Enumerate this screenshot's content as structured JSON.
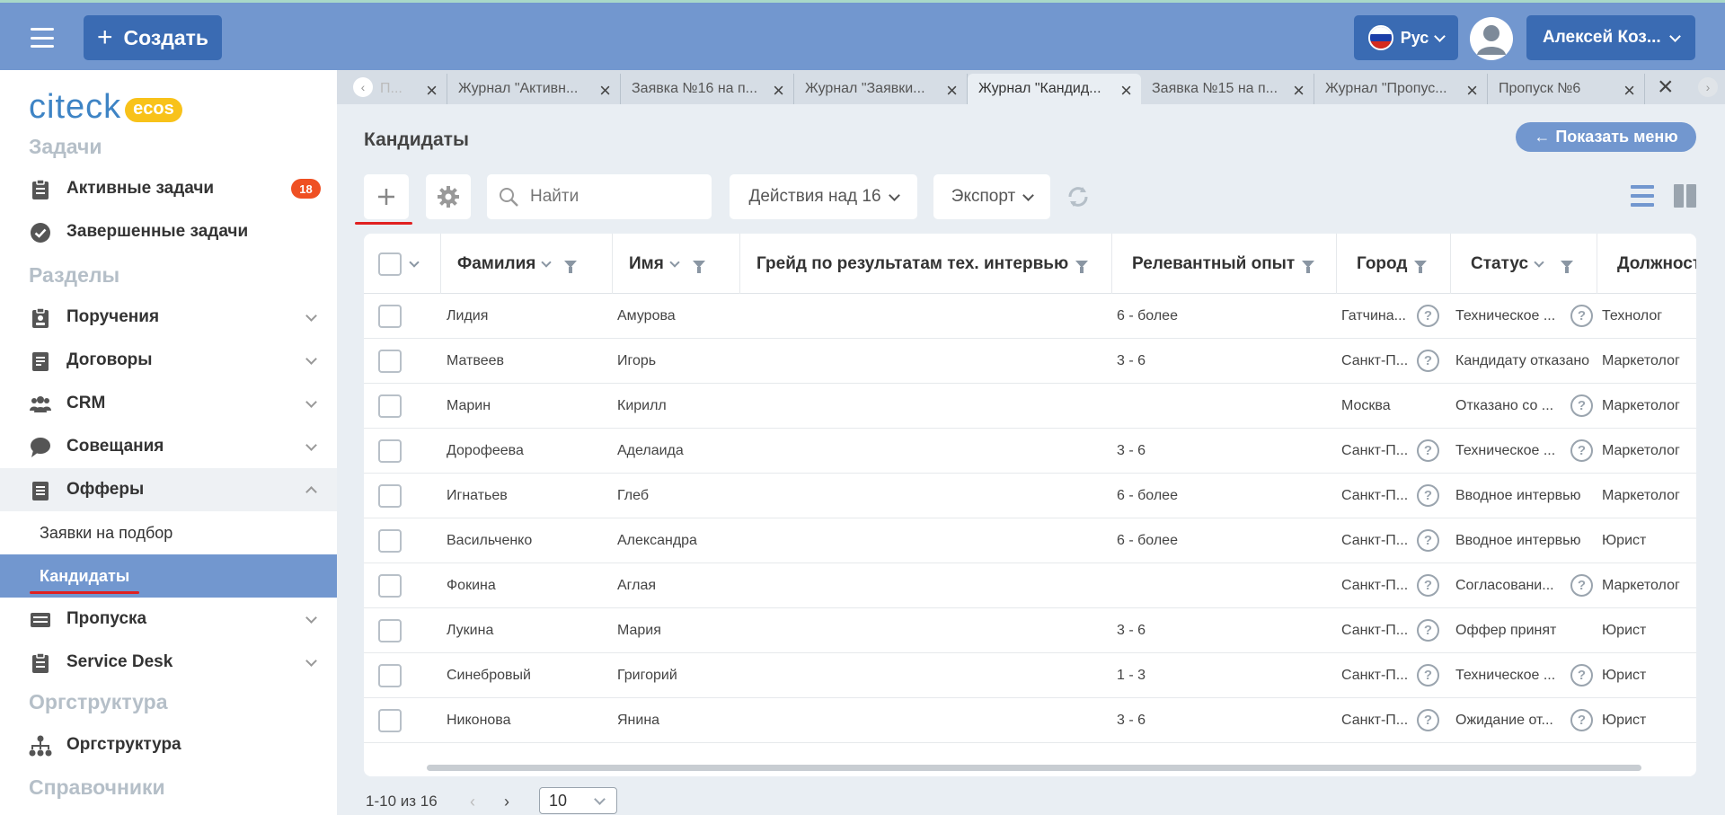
{
  "header": {
    "create_label": "Создать",
    "lang_label": "Рус",
    "user_name": "Алексей Коз..."
  },
  "sidebar": {
    "logo_text": "citeck",
    "logo_badge": "ecos",
    "sections": {
      "tasks": "Задачи",
      "sections": "Разделы",
      "orgstructure": "Оргструктура",
      "references": "Справочники"
    },
    "items": {
      "active_tasks": {
        "label": "Активные задачи",
        "badge": "18"
      },
      "completed_tasks": {
        "label": "Завершенные задачи"
      },
      "assignments": {
        "label": "Поручения"
      },
      "contracts": {
        "label": "Договоры"
      },
      "crm": {
        "label": "CRM"
      },
      "meetings": {
        "label": "Совещания"
      },
      "offers": {
        "label": "Офферы"
      },
      "offers_requests": {
        "label": "Заявки на подбор"
      },
      "offers_candidates": {
        "label": "Кандидаты"
      },
      "passes": {
        "label": "Пропуска"
      },
      "service_desk": {
        "label": "Service Desk"
      },
      "org": {
        "label": "Оргструктура"
      }
    }
  },
  "tabs": [
    {
      "label": "П..."
    },
    {
      "label": "Журнал \"Активн..."
    },
    {
      "label": "Заявка №16 на п..."
    },
    {
      "label": "Журнал \"Заявки..."
    },
    {
      "label": "Журнал \"Кандид..."
    },
    {
      "label": "Заявка №15 на п..."
    },
    {
      "label": "Журнал \"Пропус..."
    },
    {
      "label": "Пропуск №6"
    }
  ],
  "page": {
    "title": "Кандидаты",
    "show_menu_label": "Показать меню"
  },
  "toolbar": {
    "search_placeholder": "Найти",
    "actions_label": "Действия над 16",
    "export_label": "Экспорт"
  },
  "table": {
    "columns": [
      "Фамилия",
      "Имя",
      "Грейд по результатам тех. интервью",
      "Релевантный опыт",
      "Город",
      "Статус",
      "Должност"
    ],
    "rows": [
      {
        "last": "Лидия",
        "first": "Амурова",
        "grade": "",
        "exp": "6 - более",
        "city": "Гатчина...",
        "city_q": true,
        "status": "Техническое ...",
        "status_q": true,
        "position": "Технолог"
      },
      {
        "last": "Матвеев",
        "first": "Игорь",
        "grade": "",
        "exp": "3 - 6",
        "city": "Санкт-П...",
        "city_q": true,
        "status": "Кандидату отказано",
        "status_q": false,
        "position": "Маркетолог"
      },
      {
        "last": "Марин",
        "first": "Кирилл",
        "grade": "",
        "exp": "",
        "city": "Москва",
        "city_q": false,
        "status": "Отказано со ...",
        "status_q": true,
        "position": "Маркетолог"
      },
      {
        "last": "Дорофеева",
        "first": "Аделаида",
        "grade": "",
        "exp": "3 - 6",
        "city": "Санкт-П...",
        "city_q": true,
        "status": "Техническое ...",
        "status_q": true,
        "position": "Маркетолог"
      },
      {
        "last": "Игнатьев",
        "first": "Глеб",
        "grade": "",
        "exp": "6 - более",
        "city": "Санкт-П...",
        "city_q": true,
        "status": "Вводное интервью",
        "status_q": false,
        "position": "Маркетолог"
      },
      {
        "last": "Васильченко",
        "first": "Александра",
        "grade": "",
        "exp": "6 - более",
        "city": "Санкт-П...",
        "city_q": true,
        "status": "Вводное интервью",
        "status_q": false,
        "position": "Юрист"
      },
      {
        "last": "Фокина",
        "first": "Аглая",
        "grade": "",
        "exp": "",
        "city": "Санкт-П...",
        "city_q": true,
        "status": "Согласовани...",
        "status_q": true,
        "position": "Маркетолог"
      },
      {
        "last": "Лукина",
        "first": "Мария",
        "grade": "",
        "exp": "3 - 6",
        "city": "Санкт-П...",
        "city_q": true,
        "status": "Оффер принят",
        "status_q": false,
        "position": "Юрист"
      },
      {
        "last": "Синебровый",
        "first": "Григорий",
        "grade": "",
        "exp": "1 - 3",
        "city": "Санкт-П...",
        "city_q": true,
        "status": "Техническое ...",
        "status_q": true,
        "position": "Юрист"
      },
      {
        "last": "Никонова",
        "first": "Янина",
        "grade": "",
        "exp": "3 - 6",
        "city": "Санкт-П...",
        "city_q": true,
        "status": "Ожидание от...",
        "status_q": true,
        "position": "Юрист"
      }
    ]
  },
  "pager": {
    "range_text": "1-10 из 16",
    "page_size": "10"
  },
  "colors": {
    "header": "#7297cf",
    "button": "#3a6bb3",
    "badge": "#ef5023",
    "accent_underline": "#e02020"
  }
}
